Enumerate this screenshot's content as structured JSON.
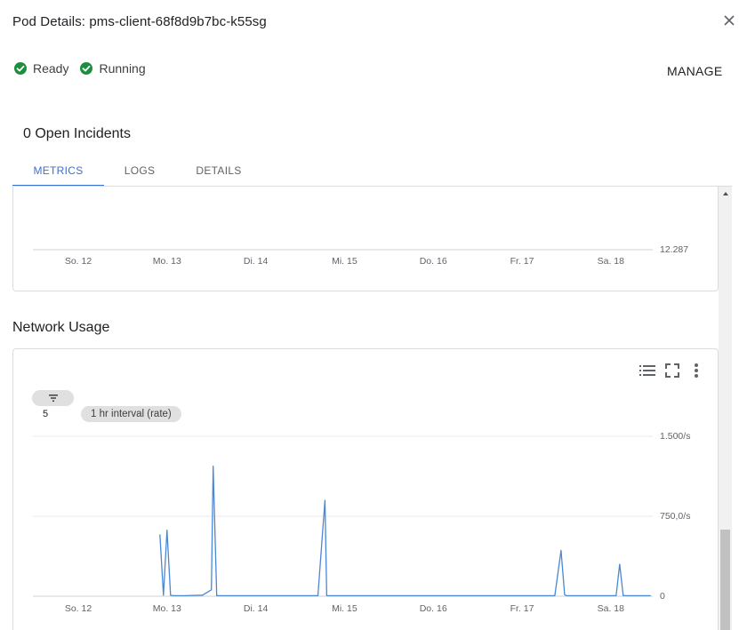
{
  "header": {
    "title": "Pod Details: pms-client-68f8d9b7bc-k55sg"
  },
  "status": [
    {
      "label": "Ready",
      "icon": "check-circle-icon",
      "color": "#1e8e3e"
    },
    {
      "label": "Running",
      "icon": "check-circle-icon",
      "color": "#1e8e3e"
    }
  ],
  "actions": {
    "manage_label": "MANAGE"
  },
  "incidents": {
    "text": "0 Open Incidents"
  },
  "tabs": [
    {
      "label": "METRICS",
      "active": true
    },
    {
      "label": "LOGS",
      "active": false
    },
    {
      "label": "DETAILS",
      "active": false
    }
  ],
  "colors": {
    "accent": "#3f6ed3",
    "status_ok": "#1e8e3e",
    "series": "#4a87d4",
    "grid": "#e8eaed"
  },
  "network": {
    "section_title": "Network Usage",
    "filter_count": "5",
    "interval_label": "1 hr interval (rate)",
    "toolbar_icons": [
      "legend-list-icon",
      "fullscreen-icon",
      "more-vert-icon"
    ]
  },
  "chart_data": [
    {
      "type": "line",
      "title": "",
      "categories": [
        "So. 12",
        "Mo. 13",
        "Di. 14",
        "Mi. 15",
        "Do. 16",
        "Fr. 17",
        "Sa. 18"
      ],
      "y_tick_labels": [
        "12.287"
      ],
      "series": [],
      "grid": true
    },
    {
      "type": "line",
      "title": "Network Usage",
      "categories": [
        "So. 12",
        "Mo. 13",
        "Di. 14",
        "Mi. 15",
        "Do. 16",
        "Fr. 17",
        "Sa. 18"
      ],
      "y_tick_labels": [
        "0",
        "750,0/s",
        "1.500/s"
      ],
      "ylim": [
        0,
        1500
      ],
      "grid": true,
      "series": [
        {
          "x": [
            0.92,
            0.96,
            1.0,
            1.04,
            1.08,
            1.2,
            1.4,
            1.5,
            1.52,
            1.56,
            1.6,
            1.8,
            2.0,
            2.4,
            2.7,
            2.78,
            2.8,
            2.84,
            3.0,
            3.5,
            4.0,
            4.5,
            5.0,
            5.3,
            5.37,
            5.44,
            5.48,
            5.5,
            6.0,
            6.06,
            6.1,
            6.14,
            6.2,
            6.45
          ],
          "y": [
            580,
            10,
            620,
            8,
            5,
            5,
            10,
            60,
            1220,
            5,
            5,
            5,
            5,
            5,
            5,
            900,
            5,
            5,
            5,
            5,
            5,
            5,
            5,
            5,
            5,
            430,
            15,
            5,
            5,
            5,
            300,
            5,
            5,
            5
          ]
        }
      ]
    }
  ]
}
